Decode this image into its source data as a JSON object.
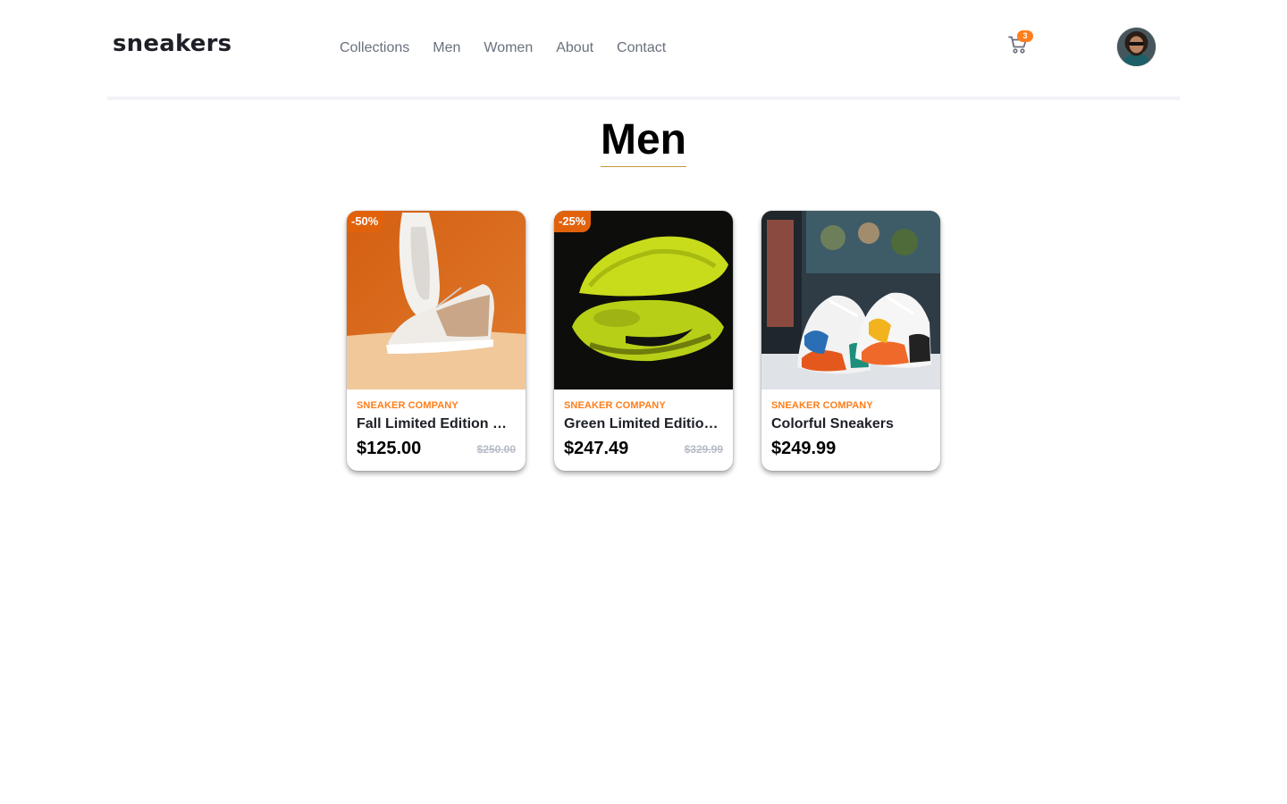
{
  "header": {
    "logo": "sneakers",
    "nav": [
      "Collections",
      "Men",
      "Women",
      "About",
      "Contact"
    ],
    "cart": {
      "icon": "cart-icon",
      "count": "3"
    },
    "avatar": {
      "icon": "user-avatar"
    }
  },
  "page": {
    "title": "Men"
  },
  "colors": {
    "accent": "#ff7e1b",
    "discount_badge": "#e2620c",
    "text_dark": "#1d2026",
    "nav_text": "#69707d",
    "old_price": "#b6bcc8"
  },
  "products": [
    {
      "discount": "-50%",
      "brand": "SNEAKER COMPANY",
      "name": "Fall Limited Edition Sneakers",
      "price": "$125.00",
      "old_price": "$250.00",
      "image": "white-sneaker-on-orange-background"
    },
    {
      "discount": "-25%",
      "brand": "SNEAKER COMPANY",
      "name": "Green Limited Edition Sneakers",
      "price": "$247.49",
      "old_price": "$329.99",
      "image": "neon-green-sneakers-on-black"
    },
    {
      "discount": "",
      "brand": "SNEAKER COMPANY",
      "name": "Colorful Sneakers",
      "price": "$249.99",
      "old_price": "",
      "image": "colorful-sneakers-on-shelf"
    }
  ]
}
